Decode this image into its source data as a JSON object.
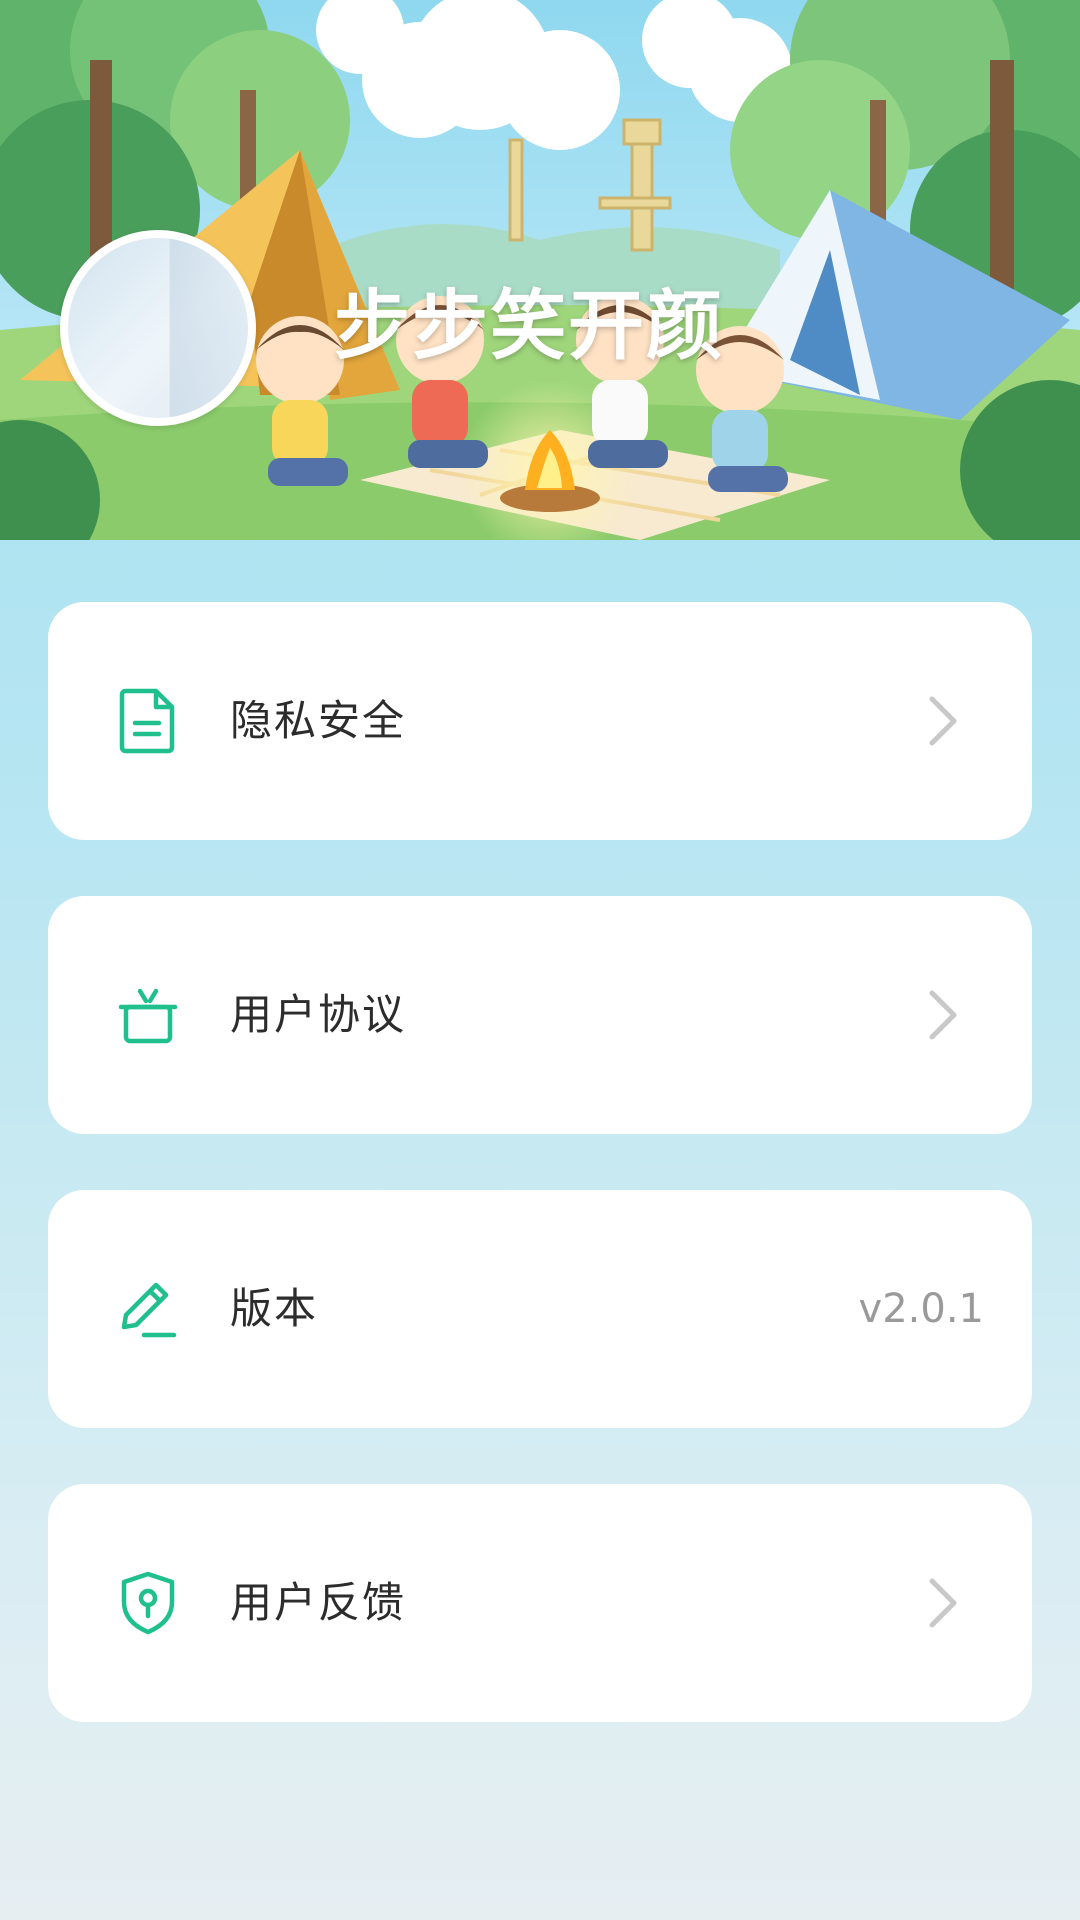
{
  "header": {
    "app_title": "步步笑开颜",
    "avatar_icon": "avatar-placeholder"
  },
  "menu": {
    "items": [
      {
        "label": "隐私安全",
        "icon": "document-icon",
        "trailing": "chevron-right-icon"
      },
      {
        "label": "用户协议",
        "icon": "gift-box-icon",
        "trailing": "chevron-right-icon"
      },
      {
        "label": "版本",
        "icon": "edit-pen-icon",
        "value": "v2.0.1"
      },
      {
        "label": "用户反馈",
        "icon": "shield-key-icon",
        "trailing": "chevron-right-icon"
      }
    ]
  },
  "colors": {
    "accent": "#1fc08e",
    "card_bg": "#ffffff",
    "chevron": "#c8c8c8",
    "value_text": "#9a9a9a"
  }
}
